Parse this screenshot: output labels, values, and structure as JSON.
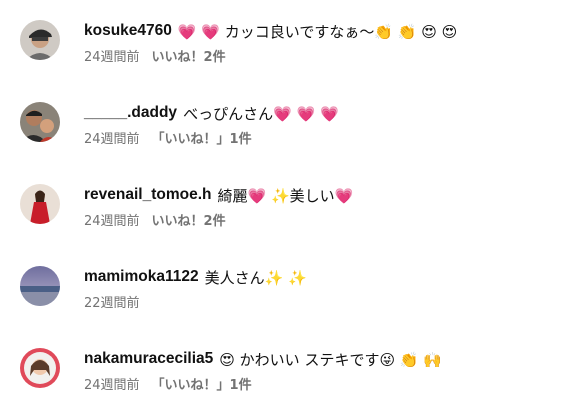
{
  "comments": [
    {
      "username": "kosuke4760",
      "text": "💗 💗 カッコ良いですなぁ〜👏 👏 😍 😍",
      "time": "24週間前",
      "likes": "いいね！2件",
      "avatar_icon": "man-in-cap-avatar"
    },
    {
      "username": "_____.daddy",
      "text": "べっぴんさん💗 💗 💗",
      "time": "24週間前",
      "likes": "「いいね！」1件",
      "avatar_icon": "father-and-child-avatar"
    },
    {
      "username": "revenail_tomoe.h",
      "text": "綺麗💗 ✨美しい💗",
      "time": "24週間前",
      "likes": "いいね！2件",
      "avatar_icon": "woman-red-dress-avatar"
    },
    {
      "username": "mamimoka1122",
      "text": "美人さん✨ ✨",
      "time": "22週間前",
      "likes": "",
      "avatar_icon": "sea-horizon-avatar"
    },
    {
      "username": "nakamuracecilia5",
      "text": "😍 かわいい ステキです😜 👏 🙌",
      "time": "24週間前",
      "likes": "「いいね！」1件",
      "avatar_icon": "woman-portrait-avatar"
    }
  ]
}
